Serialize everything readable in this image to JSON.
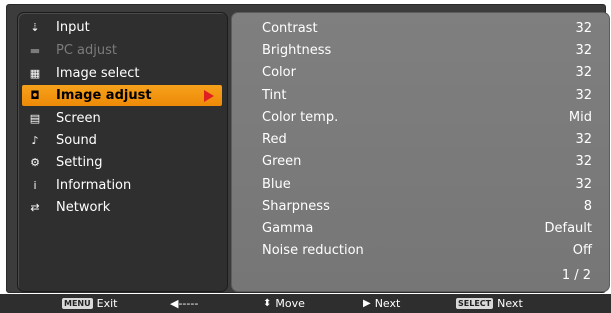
{
  "sidebar": {
    "items": [
      {
        "label": "Input",
        "icon": "input-icon",
        "glyph": "⇣"
      },
      {
        "label": "PC adjust",
        "icon": "pc-adjust-icon",
        "glyph": "▬"
      },
      {
        "label": "Image select",
        "icon": "image-select-icon",
        "glyph": "▦"
      },
      {
        "label": "Image adjust",
        "icon": "image-adjust-icon",
        "glyph": "◘"
      },
      {
        "label": "Screen",
        "icon": "screen-icon",
        "glyph": "▤"
      },
      {
        "label": "Sound",
        "icon": "sound-icon",
        "glyph": "♪"
      },
      {
        "label": "Setting",
        "icon": "setting-icon",
        "glyph": "⚙"
      },
      {
        "label": "Information",
        "icon": "information-icon",
        "glyph": "i"
      },
      {
        "label": "Network",
        "icon": "network-icon",
        "glyph": "⇄"
      }
    ],
    "active_index": 3,
    "disabled_index": 1
  },
  "settings": {
    "rows": [
      {
        "label": "Contrast",
        "value": "32"
      },
      {
        "label": "Brightness",
        "value": "32"
      },
      {
        "label": "Color",
        "value": "32"
      },
      {
        "label": "Tint",
        "value": "32"
      },
      {
        "label": "Color temp.",
        "value": "Mid"
      },
      {
        "label": "Red",
        "value": "32"
      },
      {
        "label": "Green",
        "value": "32"
      },
      {
        "label": "Blue",
        "value": "32"
      },
      {
        "label": "Sharpness",
        "value": "8"
      },
      {
        "label": "Gamma",
        "value": "Default"
      },
      {
        "label": "Noise reduction",
        "value": "Off"
      }
    ],
    "page": "1 / 2"
  },
  "footer": {
    "exit_key": "MENU",
    "exit_label": "Exit",
    "back_label": "◀-----",
    "move_label": "Move",
    "next_label": "Next",
    "select_key": "SELECT",
    "select_next_label": "Next"
  },
  "colors": {
    "accent": "#f29a12",
    "arrow": "#e02020",
    "panel": "#7a7a7a"
  }
}
